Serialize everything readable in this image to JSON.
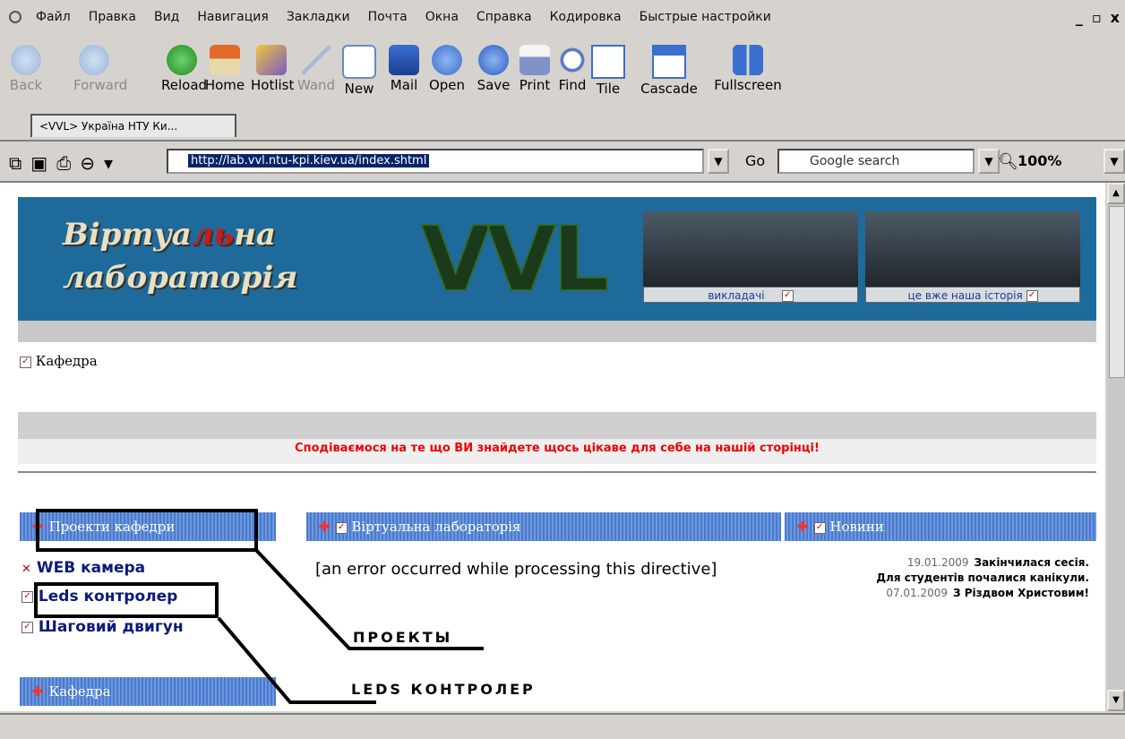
{
  "menu": {
    "items": [
      "Файл",
      "Правка",
      "Вид",
      "Навигация",
      "Закладки",
      "Почта",
      "Окна",
      "Справка",
      "Кодировка",
      "Быстрые настройки"
    ],
    "window_controls": [
      "_",
      "▫",
      "x"
    ]
  },
  "toolbar": {
    "buttons": [
      {
        "label": "Back",
        "icon": "back-icon",
        "enabled": false
      },
      {
        "label": "Forward",
        "icon": "forward-icon",
        "enabled": false
      },
      {
        "label": "Reload",
        "icon": "reload-icon",
        "enabled": true
      },
      {
        "label": "Home",
        "icon": "home-icon",
        "enabled": true
      },
      {
        "label": "Hotlist",
        "icon": "hotlist-icon",
        "enabled": true
      },
      {
        "label": "Wand",
        "icon": "wand-icon",
        "enabled": false
      },
      {
        "label": "New",
        "icon": "new-icon",
        "enabled": true
      },
      {
        "label": "Mail",
        "icon": "mail-icon",
        "enabled": true
      },
      {
        "label": "Open",
        "icon": "open-icon",
        "enabled": true
      },
      {
        "label": "Save",
        "icon": "save-icon",
        "enabled": true
      },
      {
        "label": "Print",
        "icon": "print-icon",
        "enabled": true
      },
      {
        "label": "Find",
        "icon": "find-icon",
        "enabled": true
      },
      {
        "label": "Tile",
        "icon": "tile-icon",
        "enabled": true
      },
      {
        "label": "Cascade",
        "icon": "cascade-icon",
        "enabled": true
      },
      {
        "label": "Fullscreen",
        "icon": "fullscreen-icon",
        "enabled": true
      }
    ]
  },
  "tab": {
    "title": "<VVL> Україна НТУ Ки..."
  },
  "address": {
    "url": "http://lab.vvl.ntu-kpi.kiev.ua/index.shtml",
    "go_label": "Go",
    "search_placeholder": "Google search",
    "zoom": "100%"
  },
  "page": {
    "banner": {
      "title_line1_a": "Віртуа",
      "title_line1_b": "ль",
      "title_line1_c": "на",
      "title_line2": "лабораторія",
      "logo": "VVL",
      "photo1_caption": "викладачі",
      "photo2_caption": "це вже наша історія"
    },
    "kafedra_link": "Кафедра",
    "marquee": "Сподіваємося на те що ВИ знайдете щось цікаве для себе на нашій сторінці!",
    "left_panel": {
      "header": "Проекти кафедри",
      "items": [
        "WEB камера",
        "Leds контролер",
        "Шаговий двигун"
      ],
      "header2": "Кафедра"
    },
    "middle_panel": {
      "header": "Віртуальна лабораторія",
      "text": "[an error occurred while processing this directive]"
    },
    "right_panel": {
      "header": "Новини",
      "news": [
        {
          "date": "19.01.2009",
          "text": "Закінчилася сесія."
        },
        {
          "date": "",
          "text": "Для студентів почалися канікули."
        },
        {
          "date": "07.01.2009",
          "text": "З Різдвом Христовим!"
        }
      ]
    },
    "annotations": {
      "projects_label": "ПРОЕКТЫ",
      "leds_label": "LEDS КОНТРОЛЕР"
    }
  },
  "colors": {
    "banner": "#1e6a9a",
    "panel_header": "#5b86d4",
    "marquee": "#e00000",
    "link": "#0b1a7a"
  }
}
